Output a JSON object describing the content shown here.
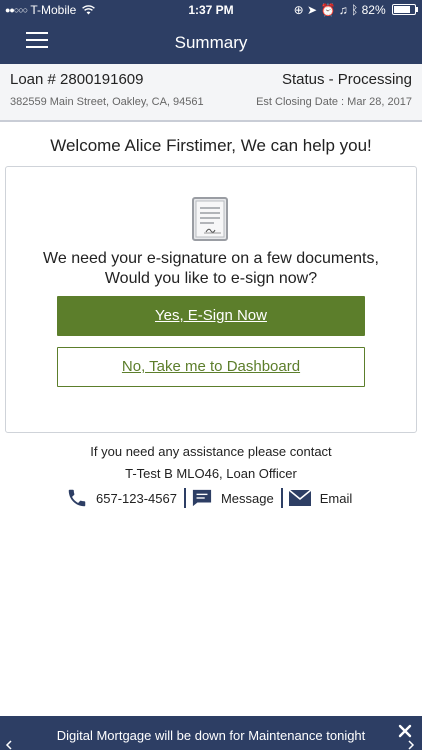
{
  "status_bar": {
    "carrier": "T-Mobile",
    "time": "1:37 PM",
    "battery": "82%",
    "battery_level": 0.82
  },
  "nav": {
    "title": "Summary",
    "menu_icon": "hamburger-menu-icon"
  },
  "loan": {
    "number": "Loan # 2800191609",
    "status": "Status - Processing",
    "address": "382559 Main Street, Oakley, CA, 94561",
    "closing": "Est Closing Date : Mar 28, 2017"
  },
  "welcome": "Welcome Alice Firstimer, We can help you!",
  "esign_card": {
    "icon": "document-signature-icon",
    "message": "We need your e-signature on a few documents, Would you like to e-sign now?",
    "yes_label": "Yes, E-Sign Now",
    "no_label": "No, Take me to Dashboard"
  },
  "assistance": {
    "text": "If you need any assistance please contact",
    "officer": "T-Test B MLO46, Loan Officer",
    "phone": "657-123-4567",
    "message_label": "Message",
    "email_label": "Email"
  },
  "banner": {
    "text": "Digital Mortgage will be down for Maintenance tonight"
  },
  "colors": {
    "navy": "#2d3e64",
    "green": "#5c7e2b"
  }
}
